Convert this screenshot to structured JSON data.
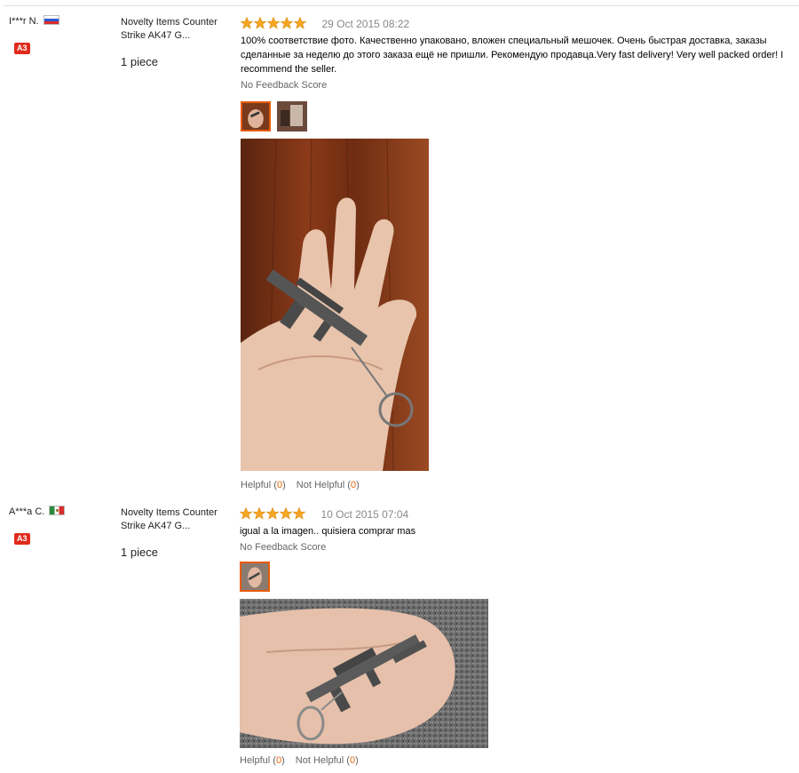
{
  "reviews": [
    {
      "user": "I***r N.",
      "flag": "ru",
      "badge": "A3",
      "product": "Novelty Items Counter Strike AK47 G...",
      "quantity": "1 piece",
      "rating": 5,
      "date": "29 Oct 2015 08:22",
      "text": "100% соответствие фото. Качественно упаковано, вложен специальный мешочек. Очень быстрая доставка, заказы сделанные за неделю до этого заказа ещё не пришли. Рекомендую продавца.Very fast delivery! Very well packed order! I recommend the seller.",
      "feedback": "No Feedback Score",
      "helpful_label": "Helpful",
      "helpful_count": "0",
      "not_helpful_label": "Not Helpful",
      "not_helpful_count": "0",
      "thumbnails": 2
    },
    {
      "user": "A***a C.",
      "flag": "mx",
      "badge": "A3",
      "product": "Novelty Items Counter Strike AK47 G...",
      "quantity": "1 piece",
      "rating": 5,
      "date": "10 Oct 2015 07:04",
      "text": "igual a la imagen.. quisiera comprar mas",
      "feedback": "No Feedback Score",
      "helpful_label": "Helpful",
      "helpful_count": "0",
      "not_helpful_label": "Not Helpful",
      "not_helpful_count": "0",
      "thumbnails": 1
    }
  ],
  "colors": {
    "star": "#f5a623",
    "accent": "#e85c0a",
    "badge": "#e02b1b"
  }
}
